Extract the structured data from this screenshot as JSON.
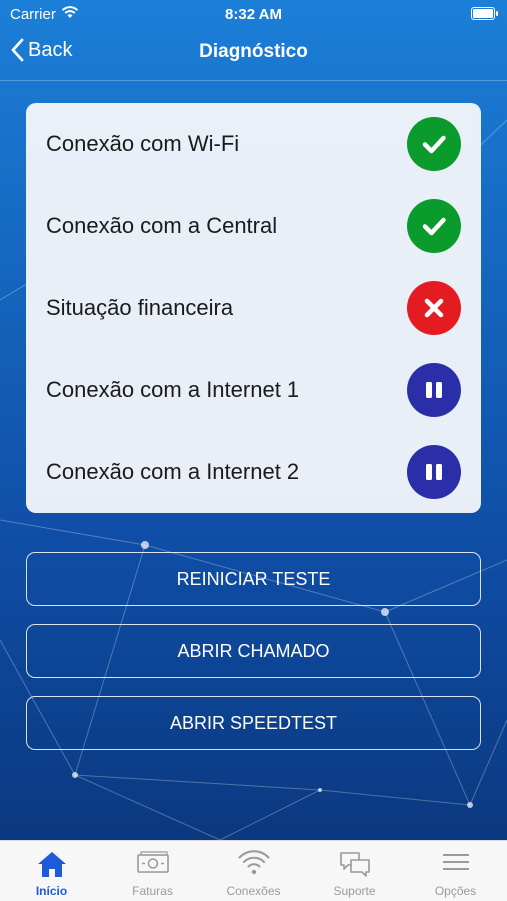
{
  "status_bar": {
    "carrier": "Carrier",
    "time": "8:32 AM"
  },
  "nav": {
    "back_label": "Back",
    "title": "Diagnóstico"
  },
  "diagnostics": [
    {
      "label": "Conexão com Wi-Fi",
      "status": "ok",
      "icon": "check-icon",
      "color": "#0b9a2c"
    },
    {
      "label": "Conexão com a Central",
      "status": "ok",
      "icon": "check-icon",
      "color": "#0b9a2c"
    },
    {
      "label": "Situação financeira",
      "status": "error",
      "icon": "x-icon",
      "color": "#e51b22"
    },
    {
      "label": "Conexão com a Internet 1",
      "status": "paused",
      "icon": "pause-icon",
      "color": "#2a2ea8"
    },
    {
      "label": "Conexão com a Internet 2",
      "status": "paused",
      "icon": "pause-icon",
      "color": "#2a2ea8"
    }
  ],
  "actions": {
    "restart": "REINICIAR TESTE",
    "open_ticket": "ABRIR CHAMADO",
    "open_speedtest": "ABRIR SPEEDTEST"
  },
  "tabs": [
    {
      "label": "Início",
      "icon": "home-icon",
      "active": true
    },
    {
      "label": "Faturas",
      "icon": "bill-icon",
      "active": false
    },
    {
      "label": "Conexões",
      "icon": "wifi-icon",
      "active": false
    },
    {
      "label": "Suporte",
      "icon": "chat-icon",
      "active": false
    },
    {
      "label": "Opções",
      "icon": "menu-icon",
      "active": false
    }
  ],
  "colors": {
    "accent": "#1d5bd8",
    "background_top": "#1c7fd8",
    "background_bottom": "#0a3478"
  }
}
